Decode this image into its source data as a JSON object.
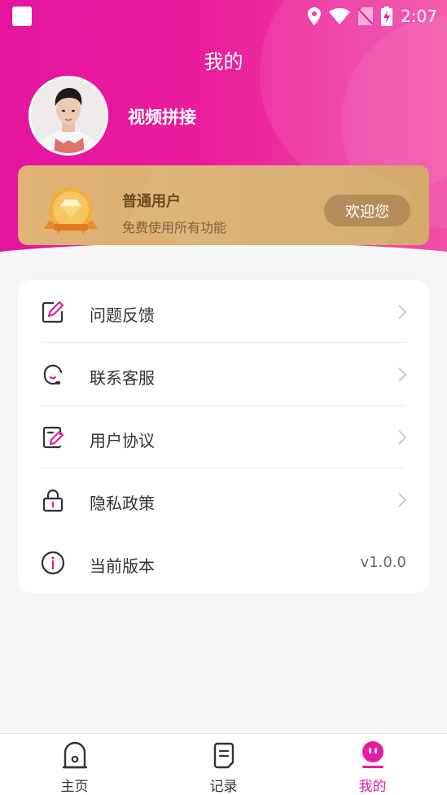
{
  "status_bar": {
    "time": "2:07"
  },
  "header": {
    "title": "我的"
  },
  "user": {
    "name": "视频拼接"
  },
  "vip_card": {
    "title": "普通用户",
    "subtitle": "免费使用所有功能",
    "button_label": "欢迎您"
  },
  "menu": {
    "items": [
      {
        "label": "问题反馈",
        "icon": "edit-icon"
      },
      {
        "label": "联系客服",
        "icon": "headset-icon"
      },
      {
        "label": "用户协议",
        "icon": "document-edit-icon"
      },
      {
        "label": "隐私政策",
        "icon": "lock-icon"
      },
      {
        "label": "当前版本",
        "icon": "info-icon",
        "value": "v1.0.0"
      }
    ]
  },
  "tab_bar": {
    "tabs": [
      {
        "label": "主页",
        "icon": "home-icon",
        "active": false
      },
      {
        "label": "记录",
        "icon": "record-icon",
        "active": false
      },
      {
        "label": "我的",
        "icon": "profile-face-icon",
        "active": true
      }
    ]
  },
  "colors": {
    "accent": "#e81aa0",
    "header_gradient_start": "#e5149f",
    "vip_gold": "#dfb476",
    "vip_button": "#b58d5a"
  }
}
